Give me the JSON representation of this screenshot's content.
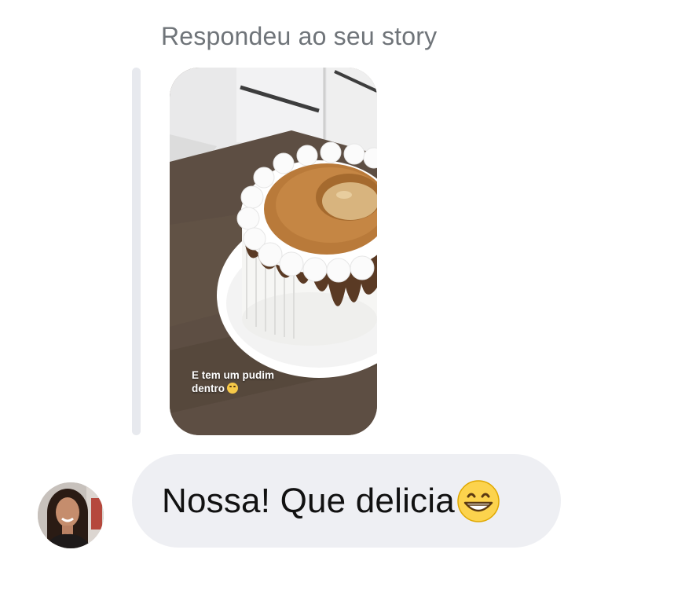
{
  "reply_header": {
    "text": "Respondeu ao seu story"
  },
  "story": {
    "caption_line1": "E tem um pudim",
    "caption_line2": "dentro"
  },
  "message": {
    "text": "Nossa! Que delicia",
    "emoji": "grinning-face-with-smiling-eyes"
  },
  "colors": {
    "bubble": "#eeeff3",
    "label": "#6f7479",
    "quote_bar": "#e7e9ee"
  }
}
